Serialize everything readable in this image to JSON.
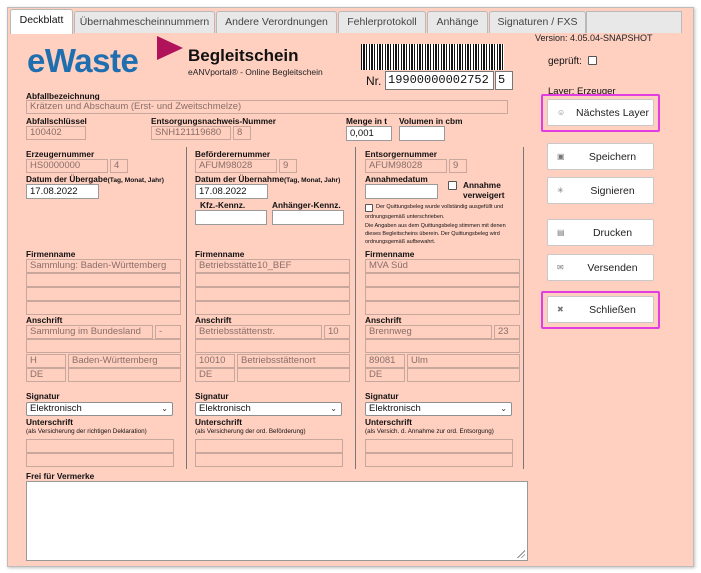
{
  "tabs": [
    "Deckblatt",
    "Übernahmescheinnummern",
    "Andere Verordnungen",
    "Fehlerprotokoll",
    "Anhänge",
    "Signaturen / FXS"
  ],
  "header": {
    "logo": "eWaste",
    "title": "Begleitschein",
    "subtitle": "eANVportal® - Online Begleitschein",
    "nr_label": "Nr.",
    "nr_value": "19900000002752",
    "nr_suffix": "5",
    "version": "Version: 4.05.04-SNAPSHOT",
    "geprueft": "geprüft:",
    "layer": "Layer: Erzeuger"
  },
  "abfall": {
    "bezeichnung_label": "Abfallbezeichnung",
    "bezeichnung": "Krätzen und Abschaum (Erst- und Zweitschmelze)",
    "schluessel_label": "Abfallschlüssel",
    "schluessel": "100402",
    "nachweis_label": "Entsorgungsnachweis-Nummer",
    "nachweis": "SNH121119680",
    "nachweis_suffix": "8",
    "menge_label": "Menge in t",
    "menge": "0,001",
    "volumen_label": "Volumen in cbm",
    "volumen": ""
  },
  "erzeuger": {
    "nr_label": "Erzeugernummer",
    "nr": "HS0000000",
    "nr_suffix": "4",
    "datum_label": "Datum der Übergabe",
    "datum_hint": "(Tag, Monat, Jahr)",
    "datum": "17.08.2022",
    "firma_label": "Firmenname",
    "firma": "Sammlung: Baden-Württemberg",
    "anschrift_label": "Anschrift",
    "strasse": "Sammlung im Bundesland",
    "hausnr": "-",
    "plz": "H",
    "ort": "Baden-Württemberg",
    "land": "DE",
    "signatur_label": "Signatur",
    "signatur": "Elektronisch",
    "unterschrift_label": "Unterschrift",
    "unterschrift_hint": "(als Versicherung der richtigen Deklaration)"
  },
  "befoerderer": {
    "nr_label": "Beförderernummer",
    "nr": "AFUM98028",
    "nr_suffix": "9",
    "datum_label": "Datum der Übernahme",
    "datum_hint": "(Tag, Monat, Jahr)",
    "datum": "17.08.2022",
    "kfz_label": "Kfz.-Kennz.",
    "anhaenger_label": "Anhänger-Kennz.",
    "firma_label": "Firmenname",
    "firma": "Betriebsstätte10_BEF",
    "anschrift_label": "Anschrift",
    "strasse": "Betriebsstättenstr.",
    "hausnr": "10",
    "plz": "10010",
    "ort": "Betriebsstättenort",
    "land": "DE",
    "signatur_label": "Signatur",
    "signatur": "Elektronisch",
    "unterschrift_label": "Unterschrift",
    "unterschrift_hint": "(als Versicherung der ord. Beförderung)"
  },
  "entsorger": {
    "nr_label": "Entsorgernummer",
    "nr": "AFUM98028",
    "nr_suffix": "9",
    "annahme_label": "Annahmedatum",
    "verweigert_line1": "Annahme",
    "verweigert_line2": "verweigert",
    "quittung_1": "Der Quittungsbeleg wurde vollständig ausgefüllt und",
    "quittung_2": "ordnungsgemäß unterschrieben.",
    "quittung_3": "Die Angaben aus dem Quittungsbeleg stimmen mit denen",
    "quittung_4": "dieses Begleitscheins überein. Der Quittungsbeleg wird",
    "quittung_5": "ordnungsgemäß aufbewahrt.",
    "firma_label": "Firmenname",
    "firma": "MVA Süd",
    "anschrift_label": "Anschrift",
    "strasse": "Brennweg",
    "hausnr": "23",
    "plz": "89081",
    "ort": "Ulm",
    "land": "DE",
    "signatur_label": "Signatur",
    "signatur": "Elektronisch",
    "unterschrift_label": "Unterschrift",
    "unterschrift_hint": "(als Versich. d. Annahme zur ord. Entsorgung)"
  },
  "remarks_label": "Frei für Vermerke",
  "buttons": {
    "next_layer": "Nächstes Layer",
    "save": "Speichern",
    "sign": "Signieren",
    "print": "Drucken",
    "send": "Versenden",
    "close": "Schließen"
  },
  "colors": {
    "panel": "#ffcfc0",
    "logo": "#1f6fb0",
    "accent_flag": "#b0135a",
    "highlight": "#e23ce3"
  }
}
